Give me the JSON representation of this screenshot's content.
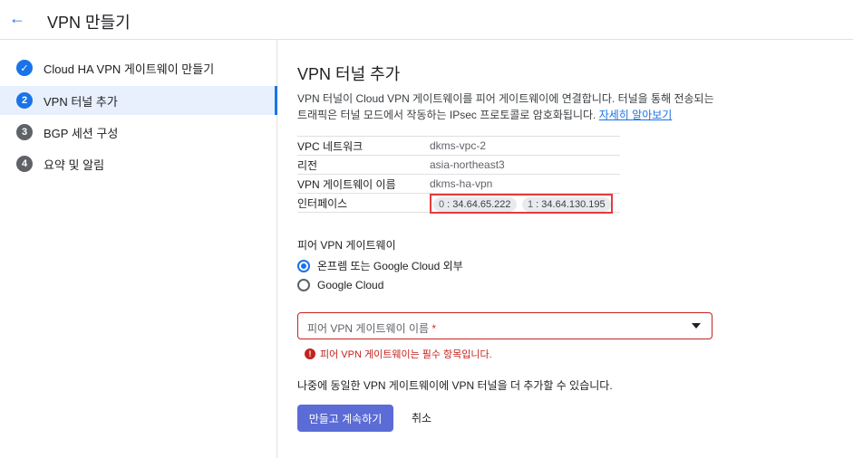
{
  "header": {
    "title": "VPN 만들기",
    "back_icon": "arrow-left-icon"
  },
  "steps": [
    {
      "num": "",
      "label": "Cloud HA VPN 게이트웨이 만들기",
      "state": "done"
    },
    {
      "num": "2",
      "label": "VPN 터널 추가",
      "state": "active"
    },
    {
      "num": "3",
      "label": "BGP 세션 구성",
      "state": "pending"
    },
    {
      "num": "4",
      "label": "요약 및 알림",
      "state": "pending"
    }
  ],
  "main": {
    "title": "VPN 터널 추가",
    "description": "VPN 터널이 Cloud VPN 게이트웨이를 피어 게이트웨이에 연결합니다. 터널을 통해 전송되는 트래픽은 터널 모드에서 작동하는 IPsec 프로토콜로 암호화됩니다.",
    "learn_more": "자세히 알아보기",
    "info": {
      "vpc_key": "VPC 네트워크",
      "vpc_value": "dkms-vpc-2",
      "region_key": "리전",
      "region_value": "asia-northeast3",
      "gw_key": "VPN 게이트웨이 이름",
      "gw_value": "dkms-ha-vpn",
      "iface_key": "인터페이스",
      "iface0_num": "0",
      "iface0_ip": "34.64.65.222",
      "iface1_num": "1",
      "iface1_ip": "34.64.130.195"
    },
    "peer_label": "피어 VPN 게이트웨이",
    "radio_onprem": "온프렘 또는 Google Cloud 외부",
    "radio_gcloud": "Google Cloud",
    "select_placeholder": "피어 VPN 게이트웨이 이름",
    "required_mark": "*",
    "error_text": "피어 VPN 게이트웨이는 필수 항목입니다.",
    "note": "나중에 동일한 VPN 게이트웨이에 VPN 터널을 더 추가할 수 있습니다.",
    "primary_button": "만들고 계속하기",
    "cancel_button": "취소"
  },
  "colors": {
    "accent": "#1a73e8",
    "primary_button": "#5b6cd6",
    "error": "#c5221f",
    "highlight_box": "#e33b3b"
  }
}
